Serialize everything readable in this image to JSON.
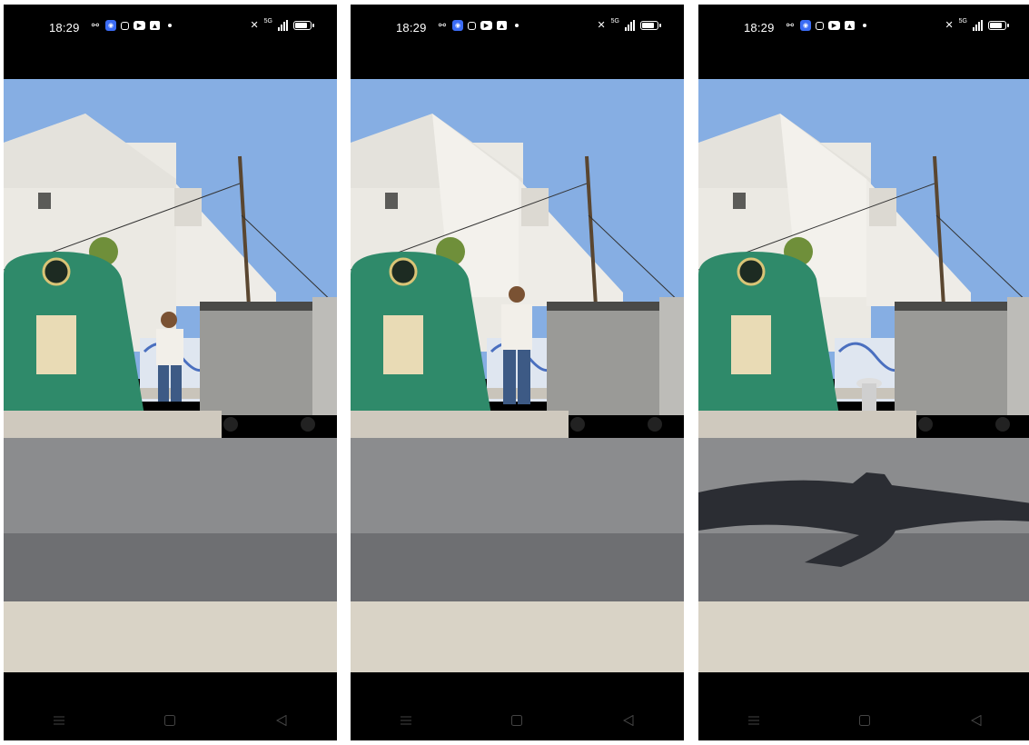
{
  "screens": [
    {
      "time": "18:29",
      "frame": "person-sitting"
    },
    {
      "time": "18:29",
      "frame": "person-standing"
    },
    {
      "time": "18:29",
      "frame": "empty-bench"
    }
  ],
  "status_icons": [
    "activity-icon",
    "messenger-icon",
    "instagram-icon",
    "youtube-icon",
    "gallery-icon",
    "notification-dot"
  ],
  "status_right": {
    "network": "5G",
    "battery_level": 0.7
  },
  "nav_buttons": [
    "menu-nav-icon",
    "home-nav-icon",
    "back-nav-icon"
  ],
  "colors": {
    "sky": "#86aee3",
    "bin_green": "#2f8a6a",
    "asphalt": "#8b8c8e"
  }
}
